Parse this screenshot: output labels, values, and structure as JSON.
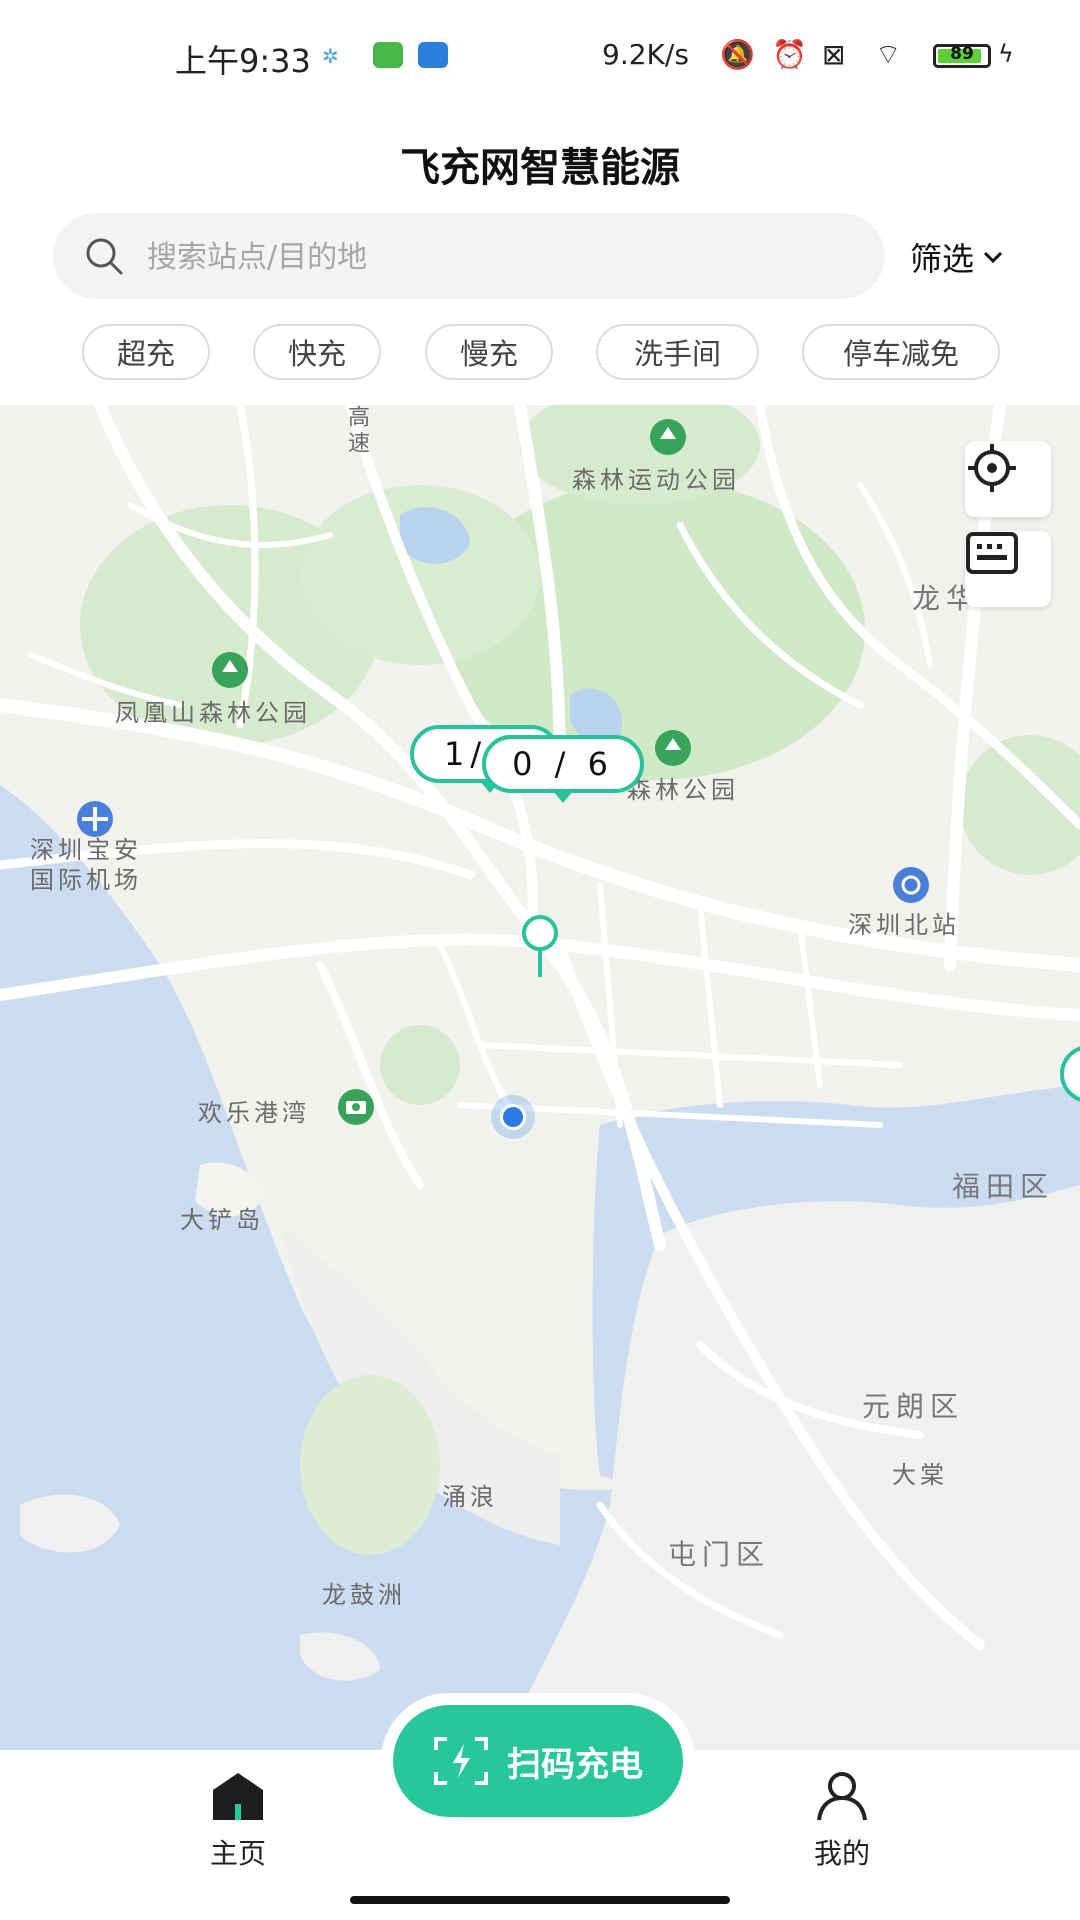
{
  "status_bar": {
    "time": "上午9:33",
    "network_speed": "9.2K/s",
    "battery": "89",
    "battery_level": 0.89
  },
  "header": {
    "title": "飞充网智慧能源"
  },
  "search": {
    "placeholder": "搜索站点/目的地",
    "value": ""
  },
  "filter": {
    "label": "筛选"
  },
  "chips": [
    "超充",
    "快充",
    "慢充",
    "洗手间",
    "停车减免"
  ],
  "map": {
    "labels": {
      "forest_sports_park": "森林运动公园",
      "longhua": "龙华",
      "fenghuangshan": "凤凰山森林公园",
      "forest_park_2": "森林公园",
      "airport": "深圳宝安\n国际机场",
      "shenzhen_north": "深圳北站",
      "happy_harbour": "欢乐港湾",
      "futian": "福田区",
      "dachan": "大铲岛",
      "yuen_long": "元朗区",
      "tai_kei": "大棠",
      "yonglang": "涌浪",
      "tuen_mun": "屯门区",
      "lung_kwu_chau": "龙鼓洲",
      "expressway": "高速"
    },
    "station_bubbles": [
      "1/",
      "0 / 6"
    ]
  },
  "bottom_nav": {
    "home": "主页",
    "scan": "扫码充电",
    "mine": "我的"
  },
  "colors": {
    "accent": "#28c79b",
    "user_location": "#2c7be5"
  }
}
